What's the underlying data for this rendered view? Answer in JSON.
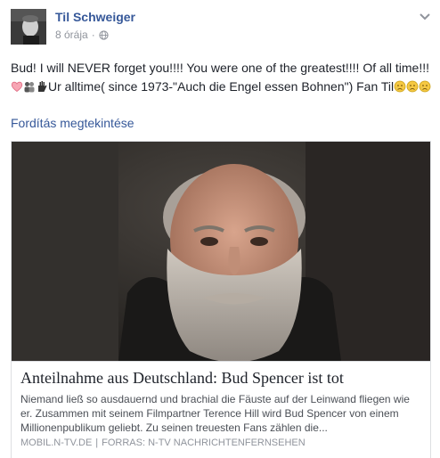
{
  "post": {
    "author": "Til Schweiger",
    "time": "8 órája",
    "meta_separator": "·",
    "text_part1": "Bud! I will NEVER forget you!!!! You were one of the greatest!!!! Of all time!!! ",
    "text_part2": "Ur alltime( since 1973-\"Auch die Engel essen Bohnen\") Fan Til",
    "translate_link": "Fordítás megtekintése"
  },
  "icons": {
    "avatar": "profile-photo",
    "globe": "globe-icon",
    "chevron": "chevron-down-icon",
    "emojis_inline": [
      "heart-icon",
      "people-icon",
      "waving-hand-icon"
    ],
    "emojis_trailing": [
      "crying-face-icon",
      "crying-face-icon",
      "crying-face-icon"
    ]
  },
  "link_preview": {
    "title": "Anteilnahme aus Deutschland: Bud Spencer ist tot",
    "description": "Niemand ließ so ausdauernd und brachial die Fäuste auf der Leinwand fliegen wie er. Zusammen mit seinem Filmpartner Terence Hill wird Bud Spencer von einem Millionenpublikum geliebt. Zu seinen treuesten Fans zählen die...",
    "domain": "MOBIL.N-TV.DE",
    "source_separator": "|",
    "source": "FORRAS: N-TV NACHRICHTENFERNSEHEN"
  },
  "colors": {
    "link_blue": "#365899",
    "text": "#1d2129",
    "muted": "#90949c",
    "border": "#dddfe2"
  }
}
